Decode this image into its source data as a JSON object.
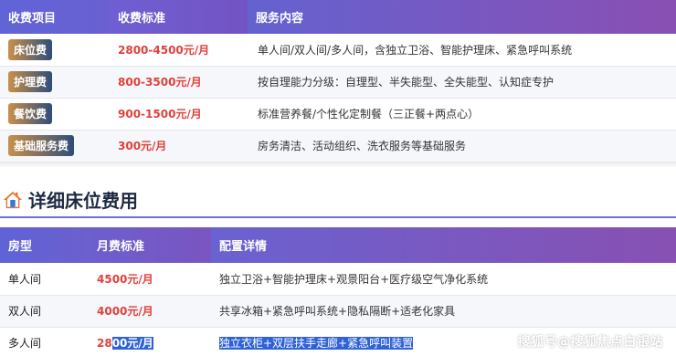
{
  "fee_table": {
    "headers": [
      "收费项目",
      "收费标准",
      "服务内容"
    ],
    "rows": [
      {
        "item": "床位费",
        "price": "2800-4500元/月",
        "desc": "单人间/双人间/多人间，含独立卫浴、智能护理床、紧急呼叫系统"
      },
      {
        "item": "护理费",
        "price": "800-3500元/月",
        "desc": "按自理能力分级：自理型、半失能型、全失能型、认知症专护"
      },
      {
        "item": "餐饮费",
        "price": "900-1500元/月",
        "desc": "标准营养餐/个性化定制餐（三正餐+两点心）"
      },
      {
        "item": "基础服务费",
        "price": "300元/月",
        "desc": "房务清洁、活动组织、洗衣服务等基础服务"
      }
    ]
  },
  "section": {
    "icon": "home-icon",
    "title": "详细床位费用"
  },
  "room_table": {
    "headers": [
      "房型",
      "月费标准",
      "配置详情"
    ],
    "rows": [
      {
        "type": "单人间",
        "price": "4500元/月",
        "desc": "独立卫浴+智能护理床+观景阳台+医疗级空气净化系统"
      },
      {
        "type": "双人间",
        "price": "4000元/月",
        "desc": "共享冰箱+紧急呼叫系统+隐私隔断+适老化家具"
      },
      {
        "type": "多人间",
        "price_a": "28",
        "price_b": "00元/月",
        "desc": "独立衣柜+双层扶手走廊+紧急呼叫装置"
      }
    ]
  },
  "watermark": "搜狐号@搜狐焦点白银站",
  "colors": {
    "header_start": "#5b5fd0",
    "header_end": "#8a4fb3",
    "price": "#e0413b",
    "selection": "#2f62d8"
  }
}
